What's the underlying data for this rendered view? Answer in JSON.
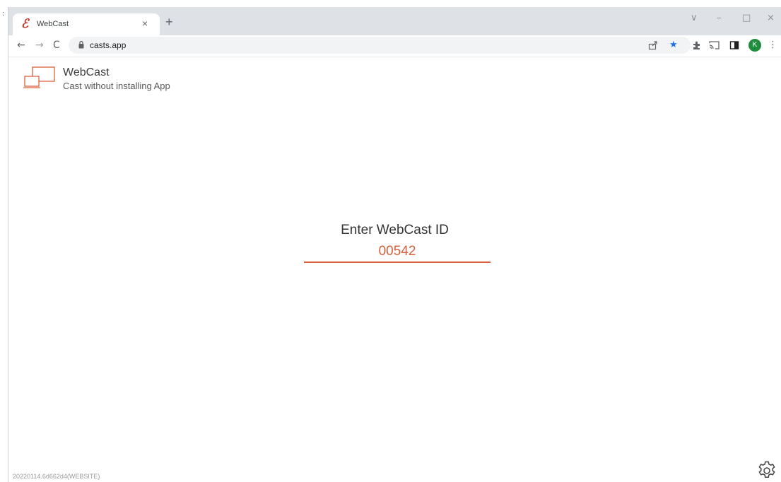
{
  "browser": {
    "tab": {
      "title": "WebCast",
      "close": "×"
    },
    "new_tab": "+",
    "window_controls": {
      "dropdown": "∨",
      "minimize": "–",
      "maximize": "□",
      "close": "×"
    },
    "nav": {
      "back": "←",
      "forward": "→",
      "reload": "C"
    },
    "address": {
      "url": "casts.app"
    },
    "profile_initial": "K",
    "menu": "⋮"
  },
  "app": {
    "name": "WebCast",
    "tagline": "Cast without installing App",
    "prompt": "Enter WebCast ID",
    "id_value": "00542",
    "version": "20220114.6d662d4(WEBSITE)"
  },
  "colors": {
    "accent": "#d9603b",
    "favicon": "#c0392b",
    "star": "#1a73e8",
    "avatar": "#1e8e3e"
  }
}
